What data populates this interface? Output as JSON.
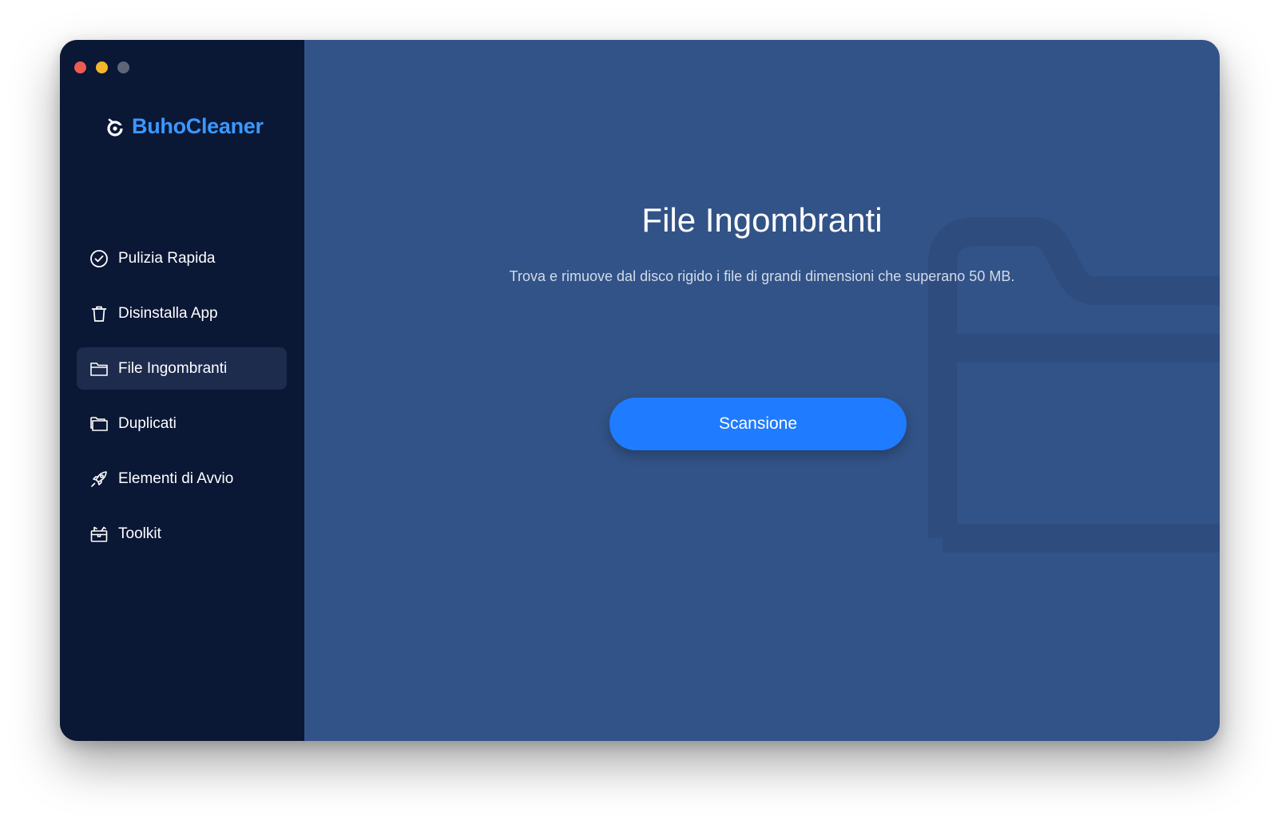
{
  "app": {
    "name": "BuhoCleaner",
    "brand_color": "#3b98ff",
    "logo_icon": "owl-logo-icon"
  },
  "window_controls": [
    "close",
    "minimize",
    "maximize"
  ],
  "sidebar": {
    "items": [
      {
        "label": "Pulizia Rapida",
        "icon": "check-circle-icon",
        "active": false
      },
      {
        "label": "Disinstalla App",
        "icon": "trash-icon",
        "active": false
      },
      {
        "label": "File Ingombranti",
        "icon": "folder-icon",
        "active": true
      },
      {
        "label": "Duplicati",
        "icon": "duplicate-folder-icon",
        "active": false
      },
      {
        "label": "Elementi di Avvio",
        "icon": "rocket-icon",
        "active": false
      },
      {
        "label": "Toolkit",
        "icon": "toolkit-icon",
        "active": false
      }
    ]
  },
  "main": {
    "title": "File Ingombranti",
    "description": "Trova e rimuove dal disco rigido i file di grandi dimensioni che superano 50 MB.",
    "scan_button": "Scansione",
    "background_icon": "folder-icon"
  },
  "colors": {
    "sidebar_bg": "#0a1735",
    "main_bg": "#325387",
    "active_item_bg": "#1d2b4d",
    "button_bg": "#1f7bff"
  }
}
